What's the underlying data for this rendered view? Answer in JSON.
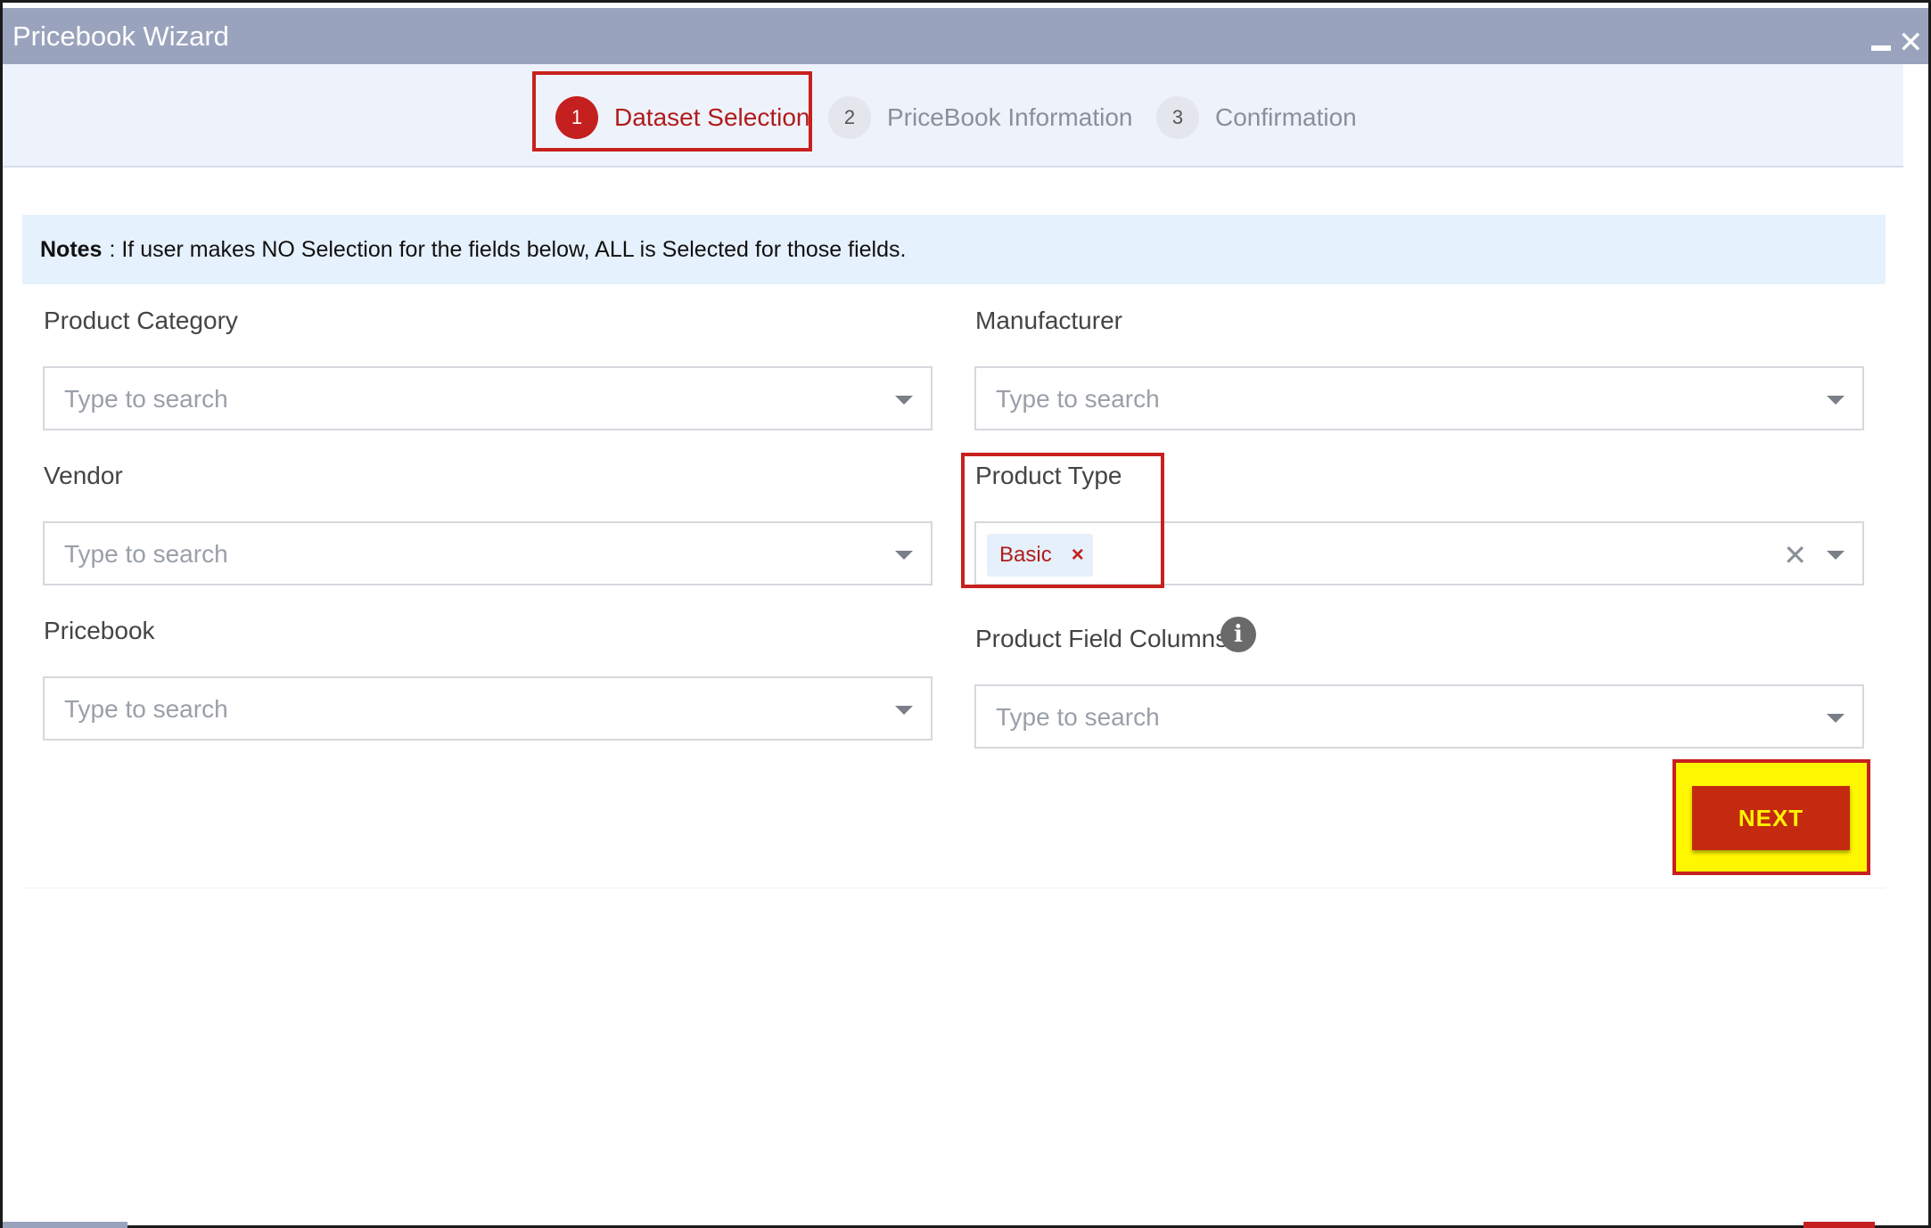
{
  "window": {
    "title": "Pricebook Wizard",
    "minimize_icon": "minimize-icon",
    "close_icon": "close-icon",
    "close_glyph": "✕"
  },
  "steps": [
    {
      "number": "1",
      "label": "Dataset Selection",
      "active": true
    },
    {
      "number": "2",
      "label": "PriceBook Information",
      "active": false
    },
    {
      "number": "3",
      "label": "Confirmation",
      "active": false
    }
  ],
  "notes": {
    "label": "Notes",
    "text": ": If user makes NO Selection for the fields below, ALL is Selected for those fields."
  },
  "fields": {
    "product_category": {
      "label": "Product Category",
      "placeholder": "Type to search"
    },
    "manufacturer": {
      "label": "Manufacturer",
      "placeholder": "Type to search"
    },
    "vendor": {
      "label": "Vendor",
      "placeholder": "Type to search"
    },
    "product_type": {
      "label": "Product Type",
      "selected_tag": "Basic",
      "tag_remove": "×",
      "clear": "✕"
    },
    "pricebook": {
      "label": "Pricebook",
      "placeholder": "Type to search"
    },
    "product_field_columns": {
      "label": "Product Field Columns",
      "placeholder": "Type to search",
      "info_glyph": "i"
    }
  },
  "actions": {
    "next_label": "NEXT"
  },
  "colors": {
    "titlebar": "#9aa3bd",
    "accent_red": "#c42020",
    "next_button": "#c42a0f",
    "next_text": "#fff200",
    "highlight_yellow": "#fff700",
    "notes_bg": "#e6f1fe"
  }
}
